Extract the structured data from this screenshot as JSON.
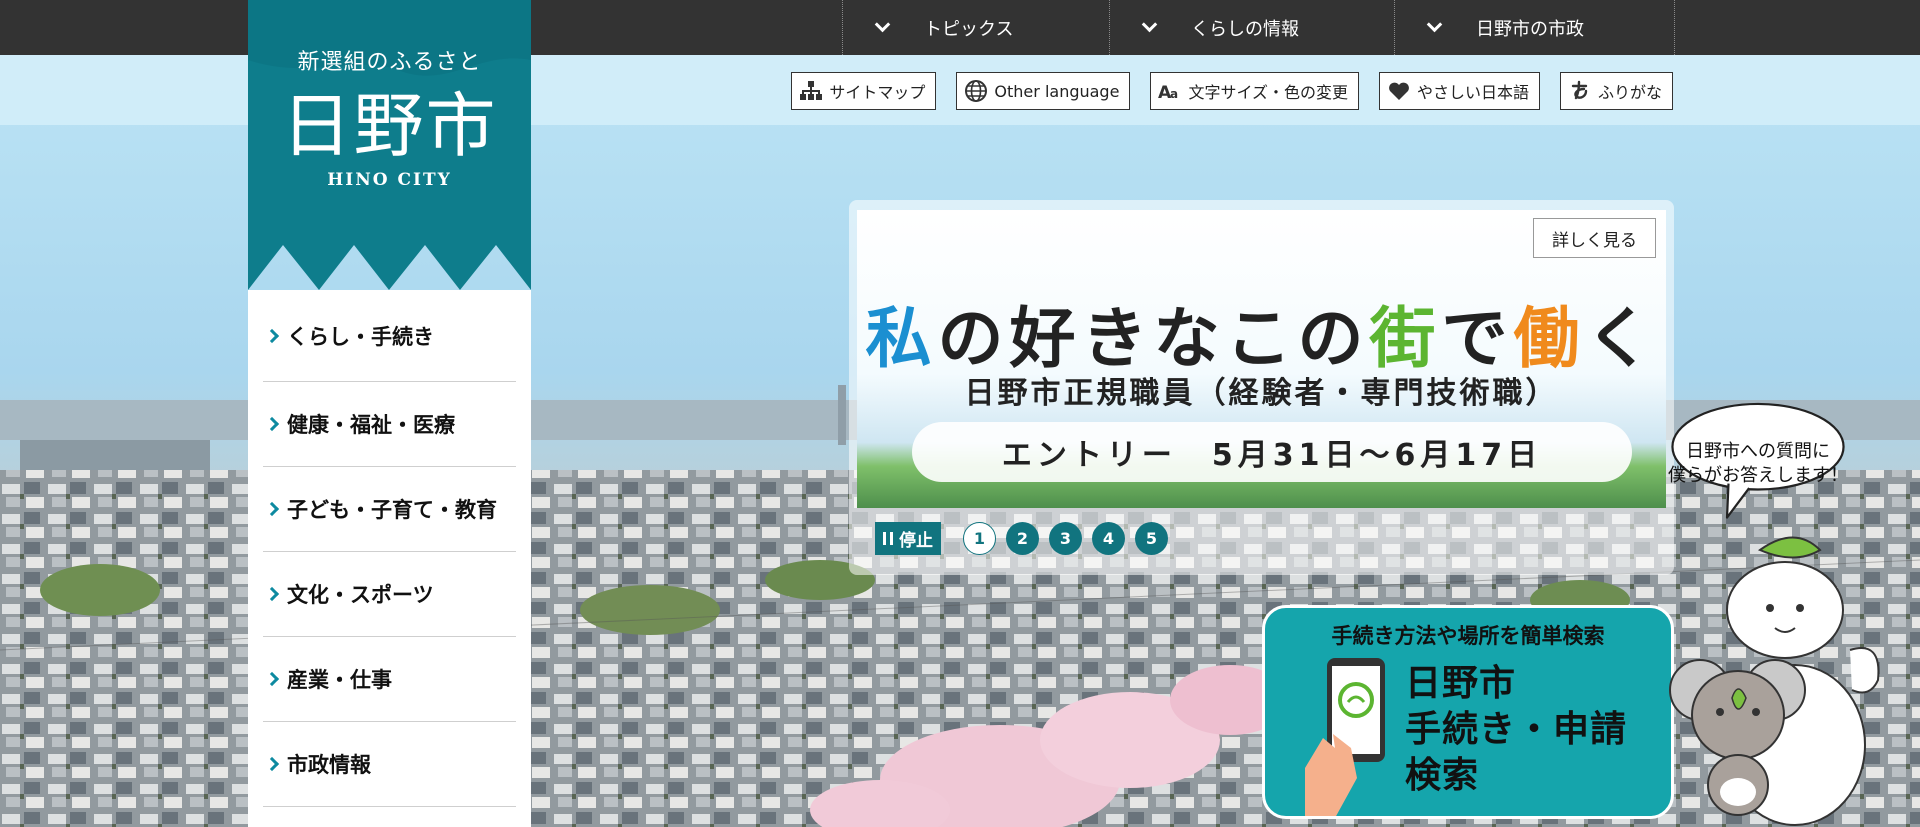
{
  "site": {
    "tagline": "新選組のふるさと",
    "name": "日野市",
    "name_en": "HINO CITY"
  },
  "top_nav": [
    {
      "label": "トピックス",
      "icon": "chevron-down-icon"
    },
    {
      "label": "くらしの情報",
      "icon": "chevron-down-icon"
    },
    {
      "label": "日野市の市政",
      "icon": "chevron-down-icon"
    }
  ],
  "utility": [
    {
      "label": "サイトマップ",
      "icon": "sitemap-icon"
    },
    {
      "label": "Other language",
      "icon": "globe-icon"
    },
    {
      "label": "文字サイズ・色の変更",
      "icon": "font-size-icon"
    },
    {
      "label": "やさしい日本語",
      "icon": "heart-icon"
    },
    {
      "label": "ふりがな",
      "icon": "hiragana-icon"
    }
  ],
  "side_nav": [
    {
      "label": "くらし・手続き"
    },
    {
      "label": "健康・福祉・医療"
    },
    {
      "label": "子ども・子育て・教育"
    },
    {
      "label": "文化・スポーツ"
    },
    {
      "label": "産業・仕事"
    },
    {
      "label": "市政情報"
    }
  ],
  "carousel": {
    "detail_label": "詳しく見る",
    "headline": {
      "p1": "私",
      "p2": "の好きなこの",
      "p3": "街",
      "p4": "で",
      "p5": "働",
      "p6": "く"
    },
    "subline": "日野市正規職員（経験者・専門技術職）",
    "entry": "エントリー　5月31日～6月17日",
    "pause_label": "停止",
    "slides": [
      "1",
      "2",
      "3",
      "4",
      "5"
    ],
    "active_slide": 1
  },
  "procedure_banner": {
    "caption": "手続き方法や場所を簡単検索",
    "line1": "日野市",
    "line2": "手続き・申請",
    "line3": "検索"
  },
  "mascot_bubble": {
    "line1": "日野市への質問に",
    "line2": "僕らがお答えします！"
  },
  "colors": {
    "brand_teal": "#11747f",
    "logo_teal": "#0e7d8c",
    "topbar": "#333333",
    "procedure_bg": "#15a5ac"
  }
}
